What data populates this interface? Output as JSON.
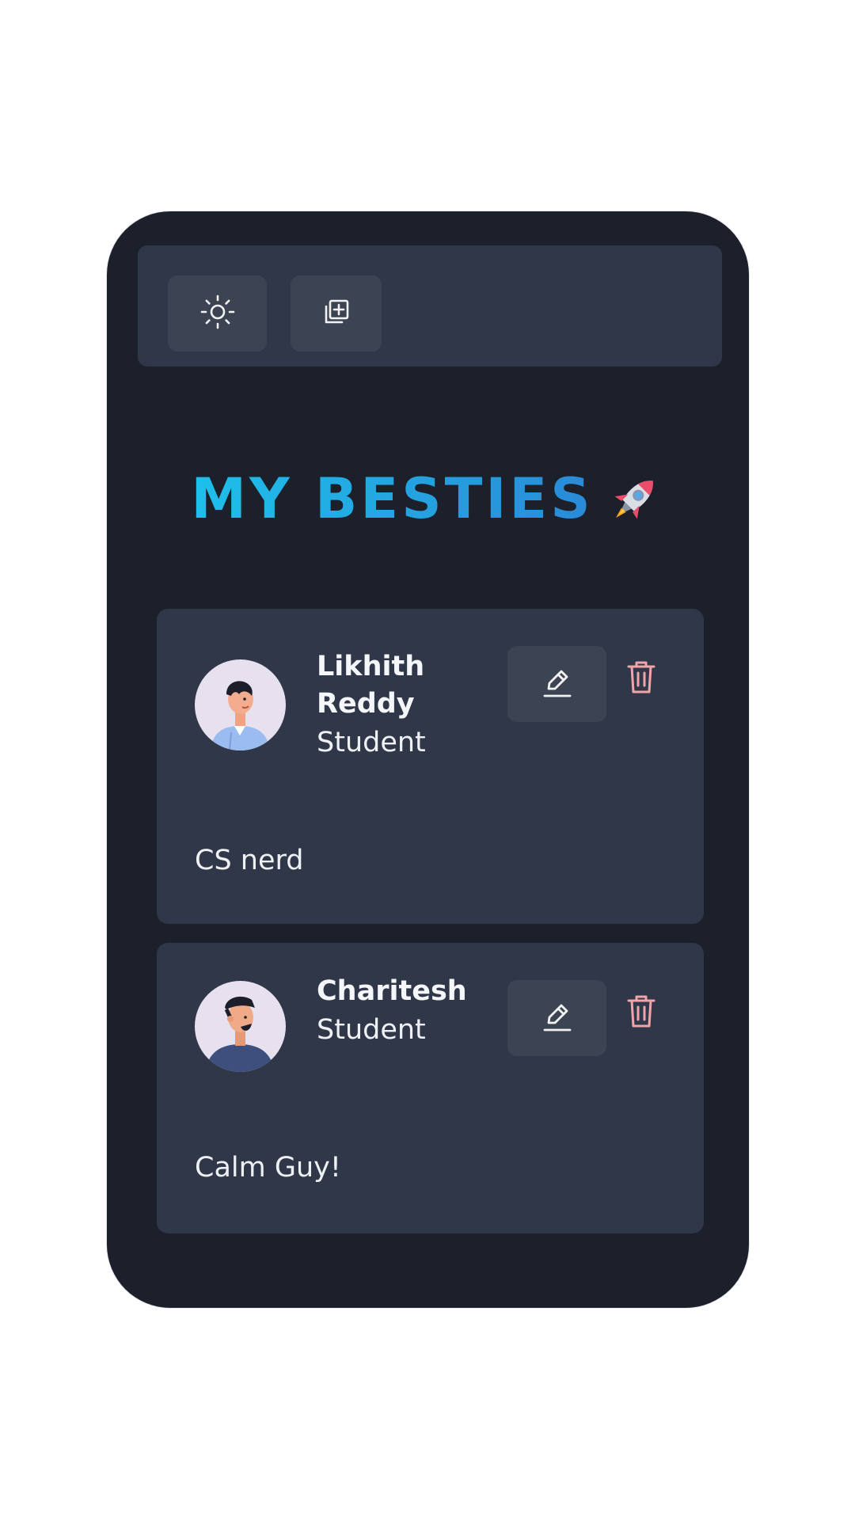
{
  "toolbar": {
    "theme_icon": "sun-icon",
    "add_icon": "add-copy-icon"
  },
  "header": {
    "title": "MY BESTIES",
    "emoji_icon": "rocket-icon",
    "gradient": [
      "#1ec0ea",
      "#2a8ad8"
    ]
  },
  "friends": [
    {
      "name": "Likhith Reddy",
      "role": "Student",
      "description": "CS nerd",
      "avatar_icon": "man-avatar-icon"
    },
    {
      "name": "Charitesh",
      "role": "Student",
      "description": "Calm Guy!",
      "avatar_icon": "man-cap-avatar-icon"
    }
  ],
  "colors": {
    "background": "#1c202b",
    "panel": "#2f3748",
    "button": "#3c4454",
    "delete": "#f2a5a8"
  }
}
